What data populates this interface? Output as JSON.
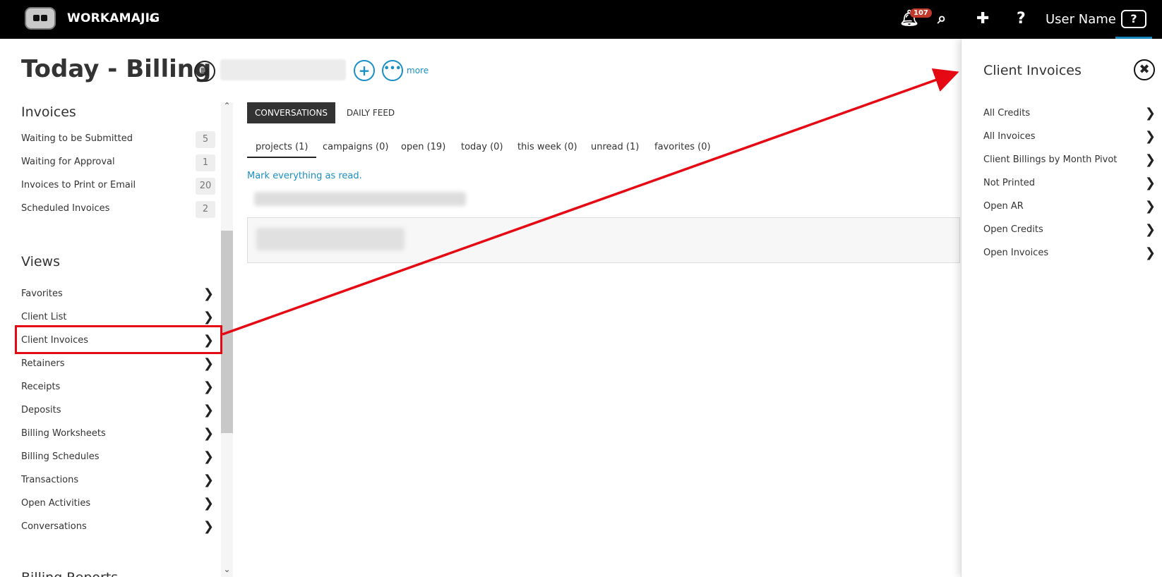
{
  "topbar": {
    "brand": "WORKAMAJIG",
    "notification_count": "107",
    "user_name": "User Name",
    "help_label": "?"
  },
  "header": {
    "title": "Today - Billing",
    "more_label": "more"
  },
  "sidebar": {
    "invoices_title": "Invoices",
    "invoices": [
      {
        "label": "Waiting to be Submitted",
        "count": "5"
      },
      {
        "label": "Waiting for Approval",
        "count": "1"
      },
      {
        "label": "Invoices to Print or Email",
        "count": "20"
      },
      {
        "label": "Scheduled Invoices",
        "count": "2"
      }
    ],
    "views_title": "Views",
    "views": [
      "Favorites",
      "Client List",
      "Client Invoices",
      "Retainers",
      "Receipts",
      "Deposits",
      "Billing Worksheets",
      "Billing Schedules",
      "Transactions",
      "Open Activities",
      "Conversations"
    ],
    "reports_title": "Billing Reports"
  },
  "main": {
    "tabs": [
      "CONVERSATIONS",
      "DAILY FEED"
    ],
    "filters": [
      "projects (1)",
      "campaigns (0)",
      "open (19)",
      "today (0)",
      "this week (0)",
      "unread (1)",
      "favorites (0)"
    ],
    "mark_read": "Mark everything as read."
  },
  "panel": {
    "title": "Client Invoices",
    "items": [
      "All Credits",
      "All Invoices",
      "Client Billings by Month Pivot",
      "Not Printed",
      "Open AR",
      "Open Credits",
      "Open Invoices"
    ]
  },
  "colors": {
    "accent": "#1a8fc4",
    "annotation": "#e50914",
    "badge": "#c0392b"
  }
}
